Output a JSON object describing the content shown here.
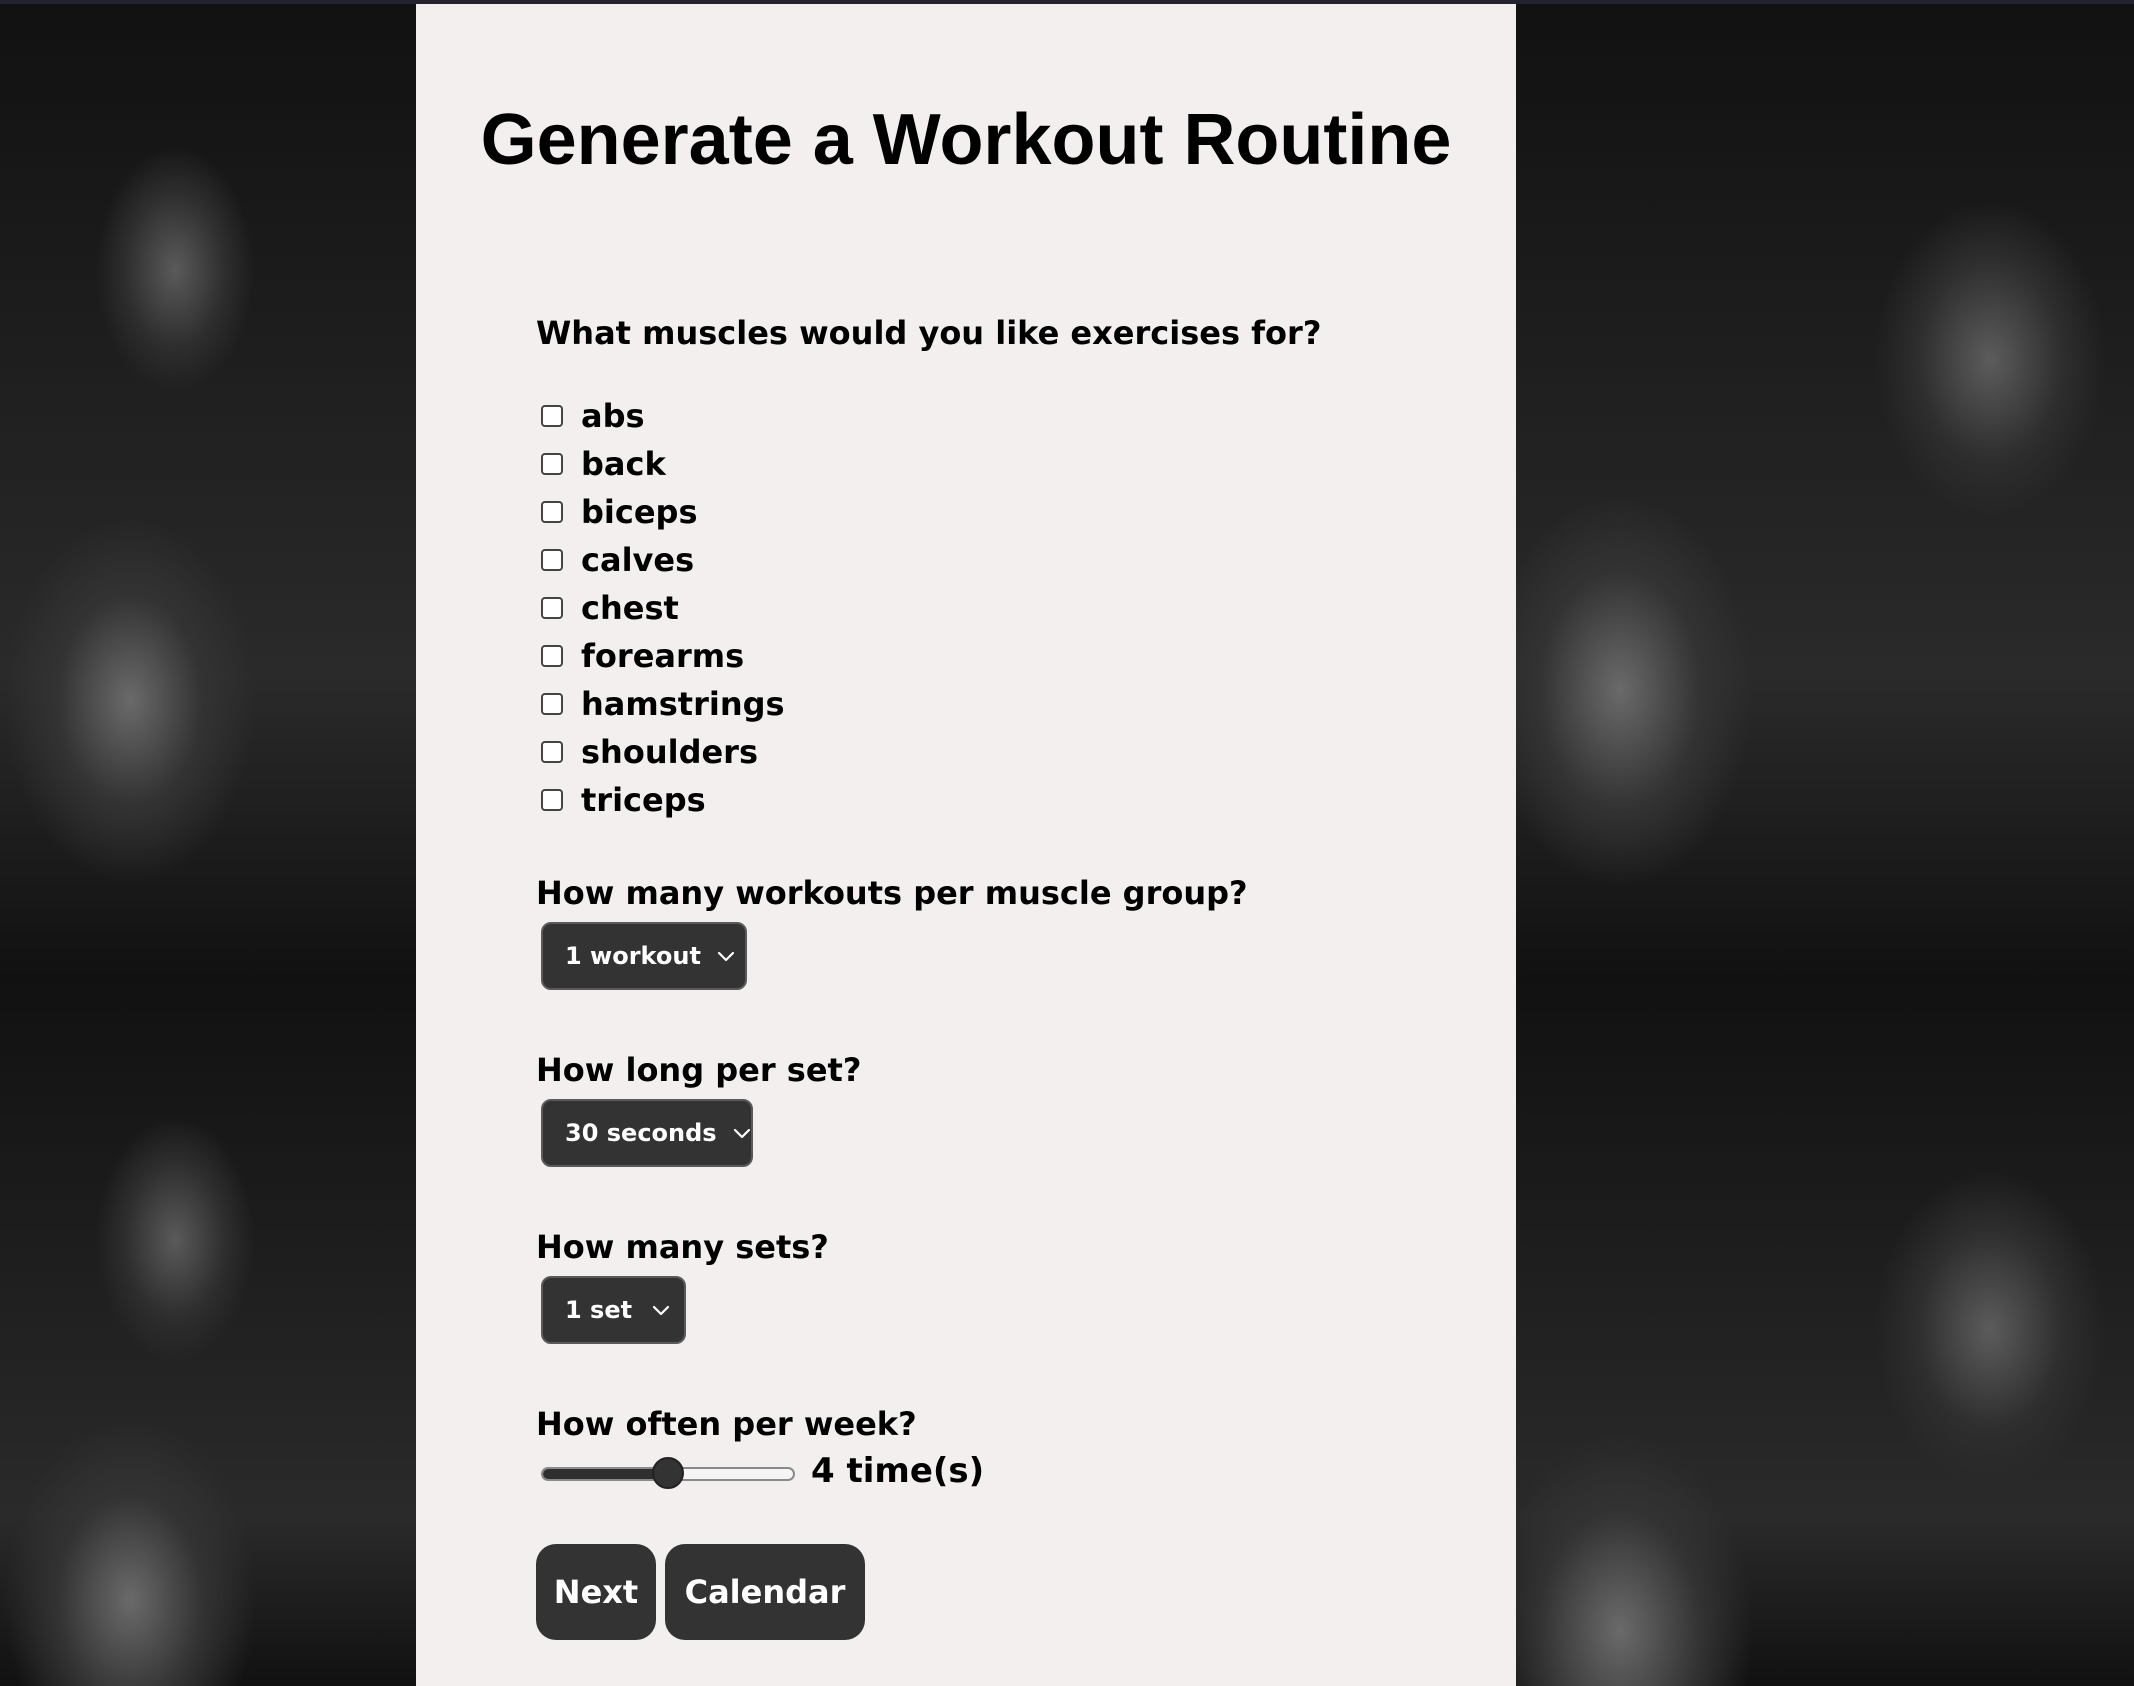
{
  "title": "Generate a Workout Routine",
  "muscles": {
    "question": "What muscles would you like exercises for?",
    "options": [
      {
        "label": "abs",
        "checked": false
      },
      {
        "label": "back",
        "checked": false
      },
      {
        "label": "biceps",
        "checked": false
      },
      {
        "label": "calves",
        "checked": false
      },
      {
        "label": "chest",
        "checked": false
      },
      {
        "label": "forearms",
        "checked": false
      },
      {
        "label": "hamstrings",
        "checked": false
      },
      {
        "label": "shoulders",
        "checked": false
      },
      {
        "label": "triceps",
        "checked": false
      }
    ]
  },
  "workouts_per_group": {
    "question": "How many workouts per muscle group?",
    "selected": "1 workout"
  },
  "set_length": {
    "question": "How long per set?",
    "selected": "30 seconds"
  },
  "sets": {
    "question": "How many sets?",
    "selected": "1 set"
  },
  "frequency": {
    "question": "How often per week?",
    "value_fraction": 0.5,
    "readout": "4 time(s)"
  },
  "buttons": {
    "next": "Next",
    "calendar": "Calendar"
  },
  "colors": {
    "panel_background": "#f2efee",
    "control_background": "#333333",
    "control_text": "#ffffff"
  }
}
